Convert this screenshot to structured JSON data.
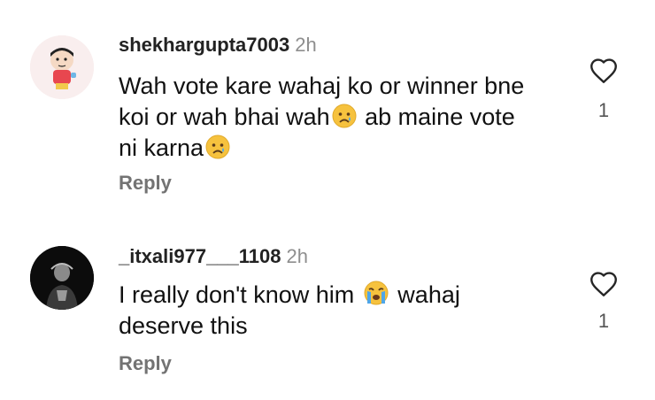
{
  "comments": [
    {
      "username": "shekhargupta7003",
      "time": "2h",
      "lines": [
        {
          "text": "Wah vote kare wahaj ko or winner bne"
        },
        {
          "text": "koi or wah bhai wah",
          "emoji_name": "crying-face-icon",
          "after": " ab maine vote"
        },
        {
          "text": "ni karna",
          "emoji_name": "crying-face-icon"
        }
      ],
      "reply_label": "Reply",
      "like_count": "1",
      "avatar_icon": "cartoon-avatar-icon"
    },
    {
      "username": "_itxali977___1108",
      "time": "2h",
      "lines": [
        {
          "text": "I really don't know him",
          "emoji_name": "loudly-crying-face-icon",
          "after": " wahaj"
        },
        {
          "text": "deserve this"
        }
      ],
      "reply_label": "Reply",
      "like_count": "1",
      "avatar_icon": "dark-portrait-avatar-icon"
    }
  ]
}
